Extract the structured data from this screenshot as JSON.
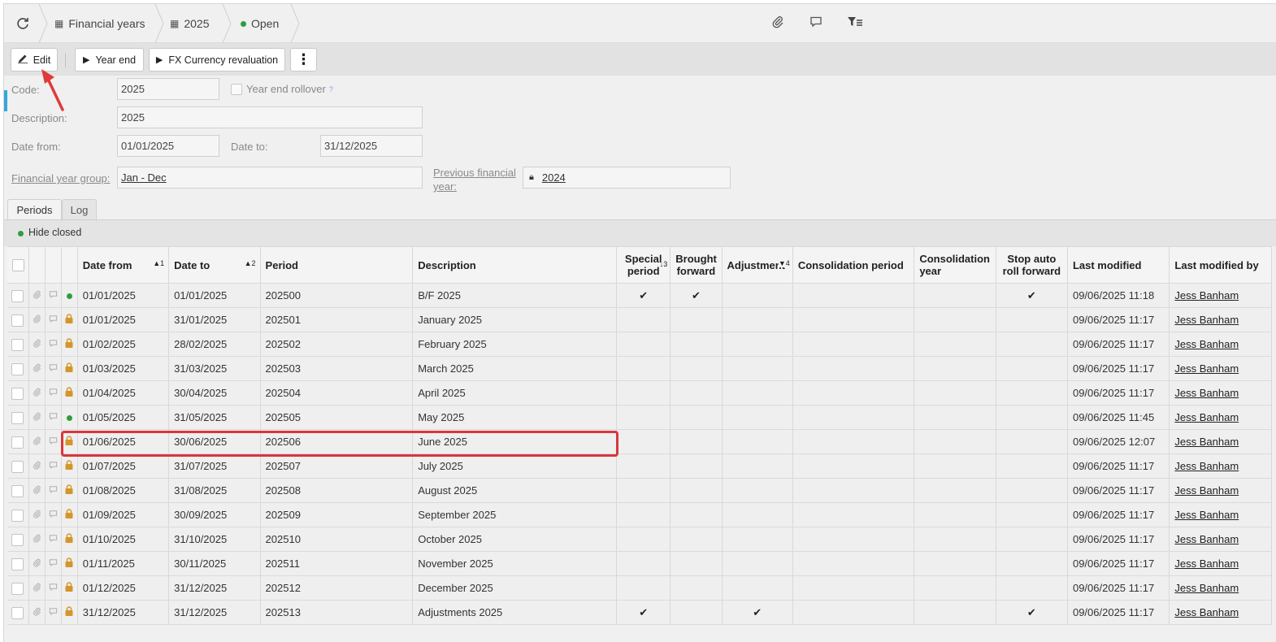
{
  "breadcrumb": {
    "refresh_icon": "refresh-icon",
    "items": [
      {
        "label": "Financial years",
        "icon": "calendar-icon"
      },
      {
        "label": "2025",
        "icon": "calendar-icon"
      },
      {
        "label": "Open",
        "icon": "status-dot"
      }
    ]
  },
  "toolbar": {
    "edit": "Edit",
    "year_end": "Year end",
    "fx": "FX Currency revaluation",
    "more": "⋮"
  },
  "form": {
    "code_label": "Code:",
    "code_value": "2025",
    "year_end_rollover_label": "Year end rollover",
    "help_mark": "?",
    "description_label": "Description:",
    "description_value": "2025",
    "date_from_label": "Date from:",
    "date_from_value": "01/01/2025",
    "date_to_label": "Date to:",
    "date_to_value": "31/12/2025",
    "fy_group_label": "Financial year group:",
    "fy_group_value": "Jan - Dec",
    "prev_fy_label_1": "Previous financial",
    "prev_fy_label_2": "year:",
    "prev_fy_value": "2024"
  },
  "tabs": {
    "periods": "Periods",
    "log": "Log"
  },
  "filter": {
    "hide_closed": "Hide closed"
  },
  "colors": {
    "accent": "#35a7dc",
    "open": "#2e9e3e",
    "locked": "#d4962a",
    "highlight": "#d9363e"
  },
  "grid": {
    "headers": {
      "date_from": "Date from",
      "date_from_sort": "▲1",
      "date_to": "Date to",
      "date_to_sort": "▲2",
      "period": "Period",
      "description": "Description",
      "special_1": "Special",
      "special_2": "period",
      "special_sort": "↓3",
      "bf_1": "Brought",
      "bf_2": "forward",
      "adjustment": "Adjustment",
      "adjustment_sort": "▼4",
      "consolidation_period": "Consolidation period",
      "cy_1": "Consolidation",
      "cy_2": "year",
      "sarf_1": "Stop auto",
      "sarf_2": "roll forward",
      "last_modified": "Last modified",
      "last_modified_by": "Last modified by"
    },
    "rows": [
      {
        "status": "open",
        "date_from": "01/01/2025",
        "date_to": "01/01/2025",
        "period": "202500",
        "description": "B/F 2025",
        "special": "✔",
        "bf": "✔",
        "adj": "",
        "stop": "✔",
        "modified": "09/06/2025 11:18",
        "by": "Jess Banham"
      },
      {
        "status": "locked",
        "date_from": "01/01/2025",
        "date_to": "31/01/2025",
        "period": "202501",
        "description": "January 2025",
        "special": "",
        "bf": "",
        "adj": "",
        "stop": "",
        "modified": "09/06/2025 11:17",
        "by": "Jess Banham"
      },
      {
        "status": "locked",
        "date_from": "01/02/2025",
        "date_to": "28/02/2025",
        "period": "202502",
        "description": "February 2025",
        "special": "",
        "bf": "",
        "adj": "",
        "stop": "",
        "modified": "09/06/2025 11:17",
        "by": "Jess Banham"
      },
      {
        "status": "locked",
        "date_from": "01/03/2025",
        "date_to": "31/03/2025",
        "period": "202503",
        "description": "March 2025",
        "special": "",
        "bf": "",
        "adj": "",
        "stop": "",
        "modified": "09/06/2025 11:17",
        "by": "Jess Banham"
      },
      {
        "status": "locked",
        "date_from": "01/04/2025",
        "date_to": "30/04/2025",
        "period": "202504",
        "description": "April 2025",
        "special": "",
        "bf": "",
        "adj": "",
        "stop": "",
        "modified": "09/06/2025 11:17",
        "by": "Jess Banham"
      },
      {
        "status": "open",
        "date_from": "01/05/2025",
        "date_to": "31/05/2025",
        "period": "202505",
        "description": "May 2025",
        "special": "",
        "bf": "",
        "adj": "",
        "stop": "",
        "modified": "09/06/2025 11:45",
        "by": "Jess Banham"
      },
      {
        "status": "locked",
        "date_from": "01/06/2025",
        "date_to": "30/06/2025",
        "period": "202506",
        "description": "June 2025",
        "special": "",
        "bf": "",
        "adj": "",
        "stop": "",
        "modified": "09/06/2025 12:07",
        "by": "Jess Banham"
      },
      {
        "status": "locked",
        "date_from": "01/07/2025",
        "date_to": "31/07/2025",
        "period": "202507",
        "description": "July 2025",
        "special": "",
        "bf": "",
        "adj": "",
        "stop": "",
        "modified": "09/06/2025 11:17",
        "by": "Jess Banham"
      },
      {
        "status": "locked",
        "date_from": "01/08/2025",
        "date_to": "31/08/2025",
        "period": "202508",
        "description": "August 2025",
        "special": "",
        "bf": "",
        "adj": "",
        "stop": "",
        "modified": "09/06/2025 11:17",
        "by": "Jess Banham"
      },
      {
        "status": "locked",
        "date_from": "01/09/2025",
        "date_to": "30/09/2025",
        "period": "202509",
        "description": "September 2025",
        "special": "",
        "bf": "",
        "adj": "",
        "stop": "",
        "modified": "09/06/2025 11:17",
        "by": "Jess Banham"
      },
      {
        "status": "locked",
        "date_from": "01/10/2025",
        "date_to": "31/10/2025",
        "period": "202510",
        "description": "October 2025",
        "special": "",
        "bf": "",
        "adj": "",
        "stop": "",
        "modified": "09/06/2025 11:17",
        "by": "Jess Banham"
      },
      {
        "status": "locked",
        "date_from": "01/11/2025",
        "date_to": "30/11/2025",
        "period": "202511",
        "description": "November 2025",
        "special": "",
        "bf": "",
        "adj": "",
        "stop": "",
        "modified": "09/06/2025 11:17",
        "by": "Jess Banham"
      },
      {
        "status": "locked",
        "date_from": "01/12/2025",
        "date_to": "31/12/2025",
        "period": "202512",
        "description": "December 2025",
        "special": "",
        "bf": "",
        "adj": "",
        "stop": "",
        "modified": "09/06/2025 11:17",
        "by": "Jess Banham"
      },
      {
        "status": "locked",
        "date_from": "31/12/2025",
        "date_to": "31/12/2025",
        "period": "202513",
        "description": "Adjustments 2025",
        "special": "✔",
        "bf": "",
        "adj": "✔",
        "stop": "✔",
        "modified": "09/06/2025 11:17",
        "by": "Jess Banham"
      }
    ]
  }
}
